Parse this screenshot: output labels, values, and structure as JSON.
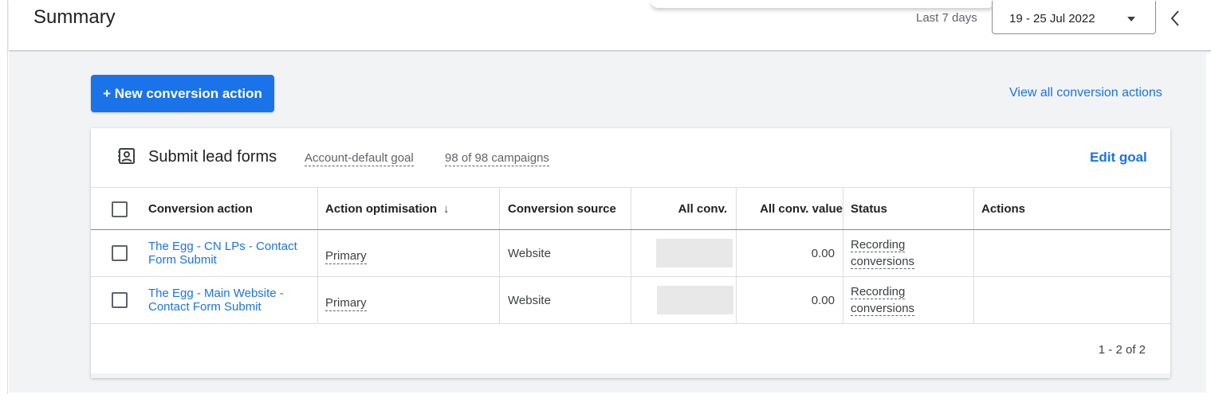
{
  "header": {
    "title": "Summary",
    "range_label": "Last 7 days",
    "date_range": "19 - 25 Jul 2022"
  },
  "toolbar": {
    "new_action_label": "+ New conversion action",
    "view_all_label": "View all conversion actions"
  },
  "goal": {
    "title": "Submit lead forms",
    "type": "Account-default goal",
    "campaigns": "98 of 98 campaigns",
    "edit_label": "Edit goal"
  },
  "table": {
    "columns": {
      "action": "Conversion action",
      "optimisation": "Action optimisation",
      "source": "Conversion source",
      "all_conv": "All conv.",
      "all_conv_value": "All conv. value",
      "status": "Status",
      "actions": "Actions"
    },
    "rows": [
      {
        "action_line1": "The Egg - CN LPs - Contact",
        "action_line2": "Form Submit",
        "optimisation": "Primary",
        "source": "Website",
        "all_conv_value": "0.00",
        "status_line1": "Recording",
        "status_line2": "conversions"
      },
      {
        "action_line1": "The Egg - Main Website -",
        "action_line2": "Contact Form Submit",
        "optimisation": "Primary",
        "source": "Website",
        "all_conv_value": "0.00",
        "status_line1": "Recording",
        "status_line2": "conversions"
      }
    ],
    "pagination": "1 - 2 of 2"
  },
  "colors": {
    "accent": "#1a73e8",
    "redacted": "#e8e8e8"
  },
  "icons": {
    "goal": "contact-form-icon",
    "dropdown": "caret-down-icon",
    "collapse": "chevron-left-icon",
    "sort": "arrow-down-icon"
  }
}
